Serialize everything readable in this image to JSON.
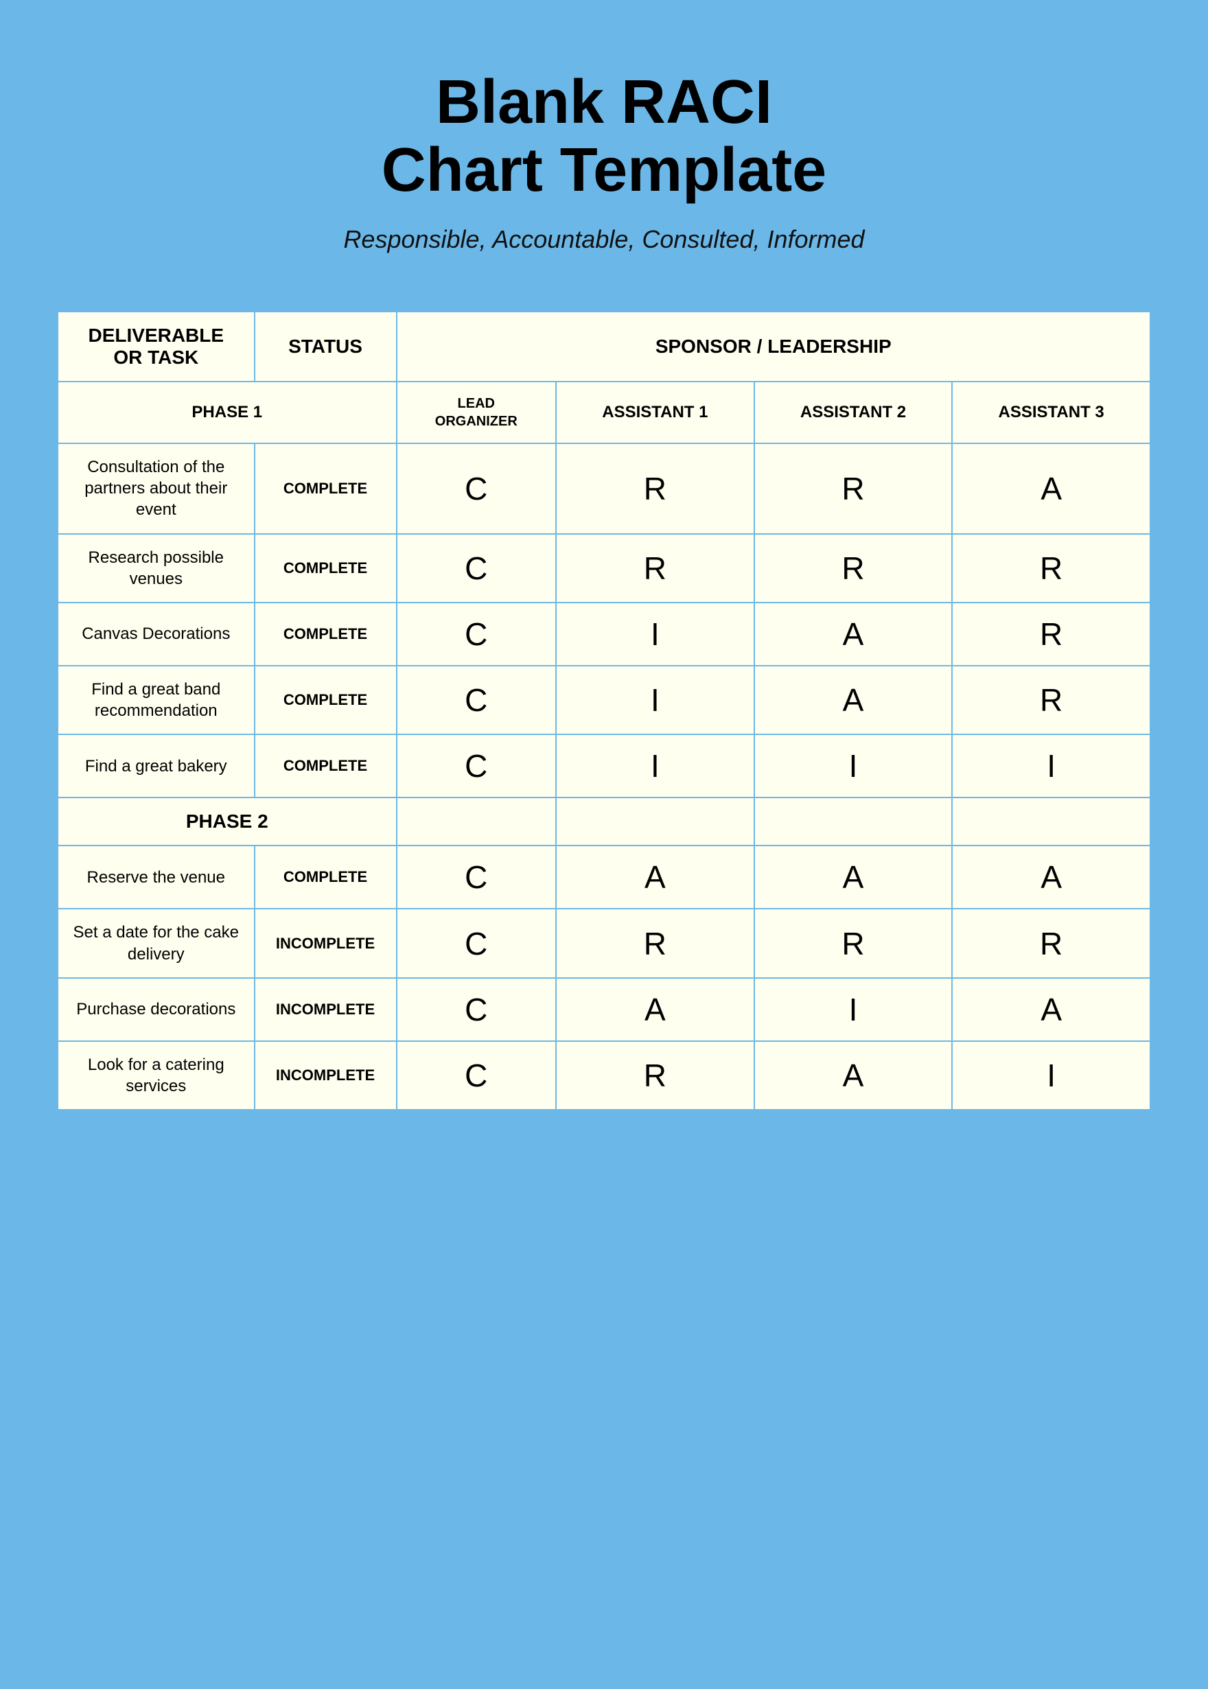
{
  "title": "Blank RACI\nChart Template",
  "subtitle": "Responsible, Accountable, Consulted, Informed",
  "table": {
    "header_top": {
      "col1": "DELIVERABLE\nOR TASK",
      "col2": "STATUS",
      "col3": "SPONSOR / LEADERSHIP"
    },
    "header_sub": {
      "phase": "PHASE 1",
      "lead": "LEAD\nORGANIZER",
      "a1": "ASSISTANT 1",
      "a2": "ASSISTANT 2",
      "a3": "ASSISTANT 3"
    },
    "rows": [
      {
        "task": "Consultation of the partners about their event",
        "status": "COMPLETE",
        "lead": "C",
        "a1": "R",
        "a2": "R",
        "a3": "A"
      },
      {
        "task": "Research possible venues",
        "status": "COMPLETE",
        "lead": "C",
        "a1": "R",
        "a2": "R",
        "a3": "R"
      },
      {
        "task": "Canvas Decorations",
        "status": "COMPLETE",
        "lead": "C",
        "a1": "I",
        "a2": "A",
        "a3": "R"
      },
      {
        "task": "Find a great band recommendation",
        "status": "COMPLETE",
        "lead": "C",
        "a1": "I",
        "a2": "A",
        "a3": "R"
      },
      {
        "task": "Find a great bakery",
        "status": "COMPLETE",
        "lead": "C",
        "a1": "I",
        "a2": "I",
        "a3": "I"
      }
    ],
    "phase2_header": "PHASE 2",
    "phase2_rows": [
      {
        "task": "Reserve the venue",
        "status": "COMPLETE",
        "lead": "C",
        "a1": "A",
        "a2": "A",
        "a3": "A"
      },
      {
        "task": "Set a date for the cake delivery",
        "status": "INCOMPLETE",
        "lead": "C",
        "a1": "R",
        "a2": "R",
        "a3": "R"
      },
      {
        "task": "Purchase decorations",
        "status": "INCOMPLETE",
        "lead": "C",
        "a1": "A",
        "a2": "I",
        "a3": "A"
      },
      {
        "task": "Look for a catering services",
        "status": "INCOMPLETE",
        "lead": "C",
        "a1": "R",
        "a2": "A",
        "a3": "I"
      }
    ]
  }
}
